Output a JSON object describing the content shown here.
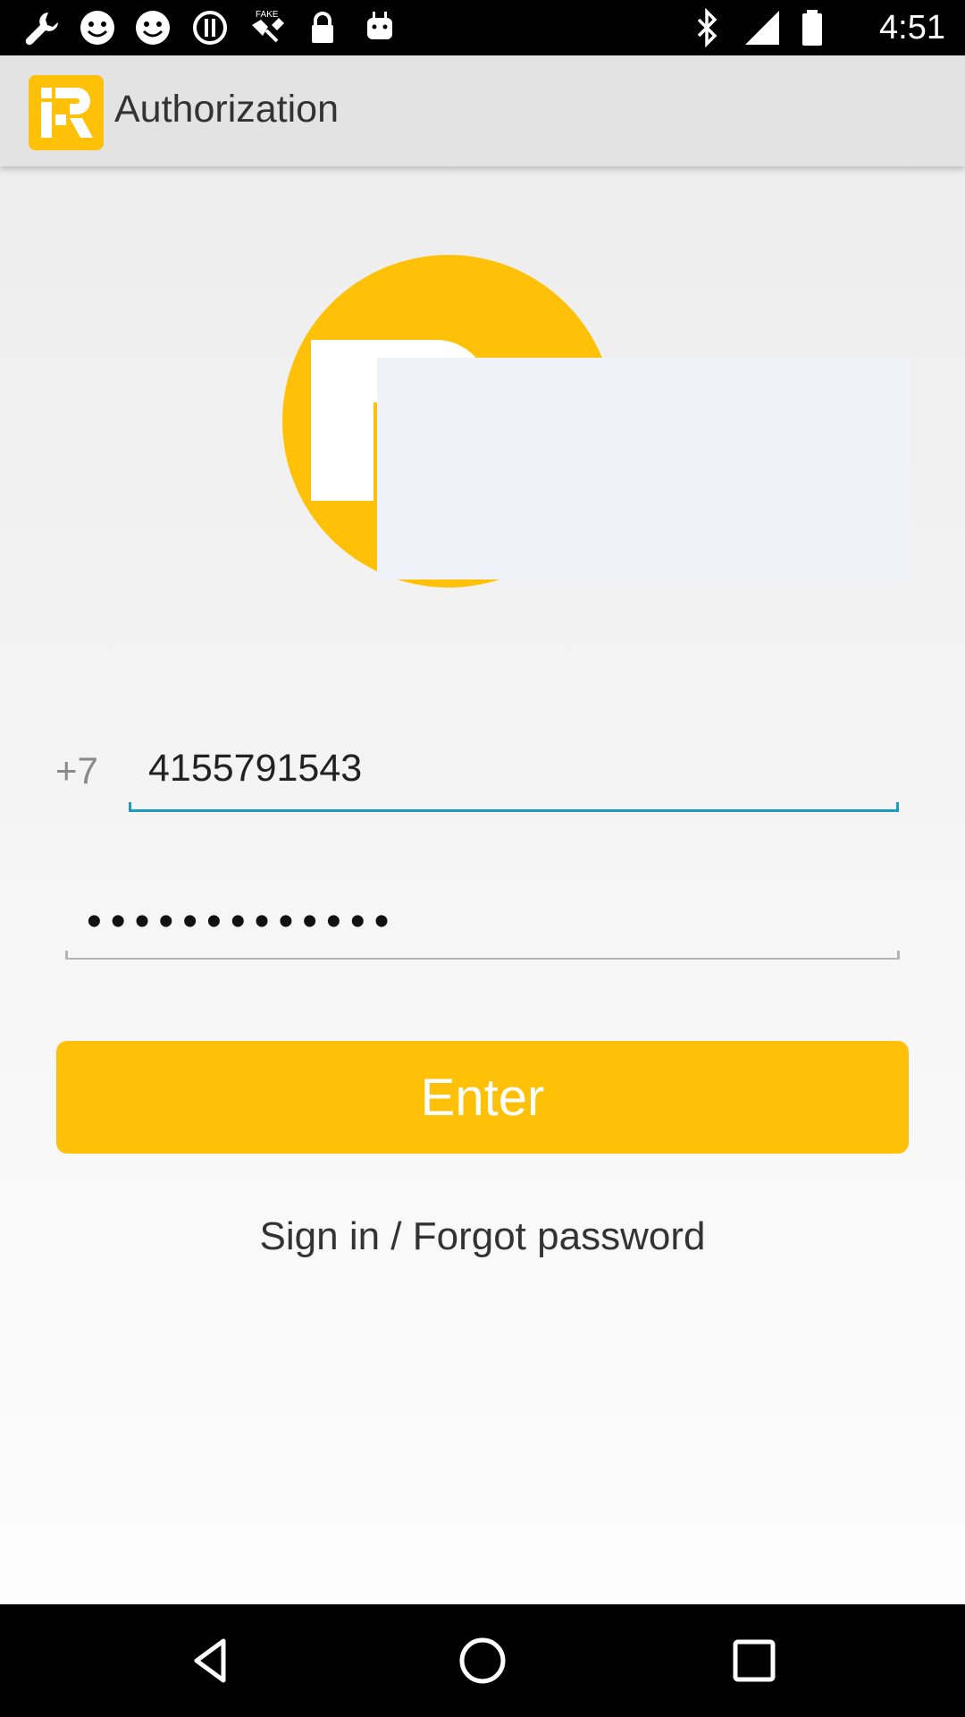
{
  "status_bar": {
    "time": "4:51",
    "left_icons": [
      "wrench-icon",
      "smiley-icon",
      "smiley-icon",
      "info-circle-icon",
      "satellite-fake-gps-icon",
      "lock-icon",
      "android-icon"
    ],
    "fake_gps_label": "FAKE",
    "right_icons": [
      "bluetooth-icon",
      "signal-icon",
      "battery-icon"
    ]
  },
  "app_bar": {
    "title": "Authorization",
    "logo_letter": "R"
  },
  "logo": {
    "letter": "R"
  },
  "form": {
    "country_code": "+7",
    "phone_value": "4155791543",
    "password_value": "•••••••••••••"
  },
  "actions": {
    "enter_label": "Enter",
    "signin_forgot_label": "Sign in / Forgot password"
  },
  "colors": {
    "accent": "#ffc107",
    "input_focus": "#1a9bbf"
  },
  "nav_bar": {
    "icons": [
      "back-icon",
      "home-icon",
      "recents-icon"
    ]
  }
}
